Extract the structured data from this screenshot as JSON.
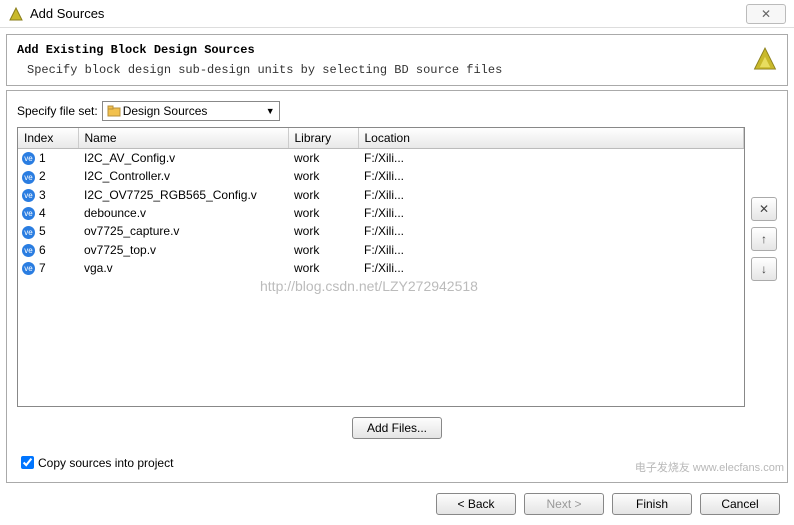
{
  "window": {
    "title": "Add Sources"
  },
  "header": {
    "subtitle": "Add Existing Block Design Sources",
    "description": "Specify block design sub-design units by selecting BD source files"
  },
  "fileset": {
    "label": "Specify file set:",
    "selected": "Design Sources"
  },
  "table": {
    "columns": {
      "index": "Index",
      "name": "Name",
      "library": "Library",
      "location": "Location"
    },
    "rows": [
      {
        "index": "1",
        "name": "I2C_AV_Config.v",
        "library": "work",
        "location": "F:/Xili..."
      },
      {
        "index": "2",
        "name": "I2C_Controller.v",
        "library": "work",
        "location": "F:/Xili..."
      },
      {
        "index": "3",
        "name": "I2C_OV7725_RGB565_Config.v",
        "library": "work",
        "location": "F:/Xili..."
      },
      {
        "index": "4",
        "name": "debounce.v",
        "library": "work",
        "location": "F:/Xili..."
      },
      {
        "index": "5",
        "name": "ov7725_capture.v",
        "library": "work",
        "location": "F:/Xili..."
      },
      {
        "index": "6",
        "name": "ov7725_top.v",
        "library": "work",
        "location": "F:/Xili..."
      },
      {
        "index": "7",
        "name": "vga.v",
        "library": "work",
        "location": "F:/Xili..."
      }
    ]
  },
  "side": {
    "remove": "✕",
    "up": "↑",
    "down": "↓"
  },
  "buttons": {
    "add_files": "Add Files...",
    "back": "< Back",
    "next": "Next >",
    "finish": "Finish",
    "cancel": "Cancel"
  },
  "checkbox": {
    "copy_sources": "Copy sources into project",
    "checked": true
  },
  "watermark": "http://blog.csdn.net/LZY272942518",
  "bottom_brand": "电子发烧友 www.elecfans.com"
}
